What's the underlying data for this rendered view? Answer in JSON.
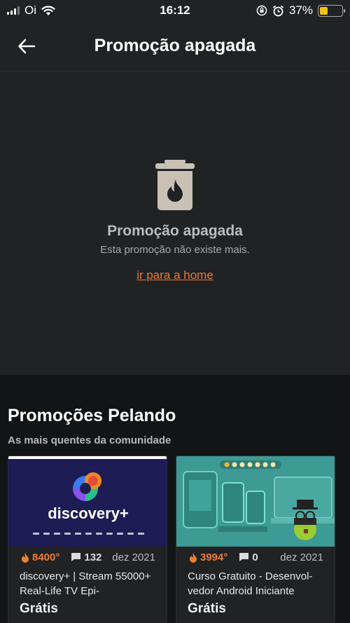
{
  "status_bar": {
    "carrier": "Oi",
    "time": "16:12",
    "battery": "37%",
    "battery_level": 0.37,
    "icons": [
      "signal-icon",
      "wifi-icon",
      "orientation-lock-icon",
      "alarm-icon",
      "battery-icon"
    ]
  },
  "header": {
    "title": "Promoção apagada",
    "back_icon": "arrow-left-icon"
  },
  "empty_state": {
    "icon": "trash-icon",
    "title": "Promoção apagada",
    "subtitle": "Esta promoção não existe mais.",
    "link": "ir para a home"
  },
  "recommendations": {
    "title": "Promoções Pelando",
    "subtitle": "As mais quentes da comunidade",
    "cards": [
      {
        "image": "discovery-plus-banner",
        "image_text": "discovery+",
        "temperature": "8400°",
        "comments": "132",
        "date": "dez 2021",
        "title": "discovery+ | Stream 55000+ Real-Life TV Epi-",
        "price": "Grátis"
      },
      {
        "image": "android-course-banner",
        "temperature": "3994°",
        "comments": "0",
        "date": "dez 2021",
        "title": "Curso Gratuito - Desenvol-vedor Android Iniciante",
        "price": "Grátis"
      }
    ]
  },
  "colors": {
    "background": "#202224",
    "section_background": "#131416",
    "accent": "#e8783a",
    "battery": "#f4c20d"
  }
}
